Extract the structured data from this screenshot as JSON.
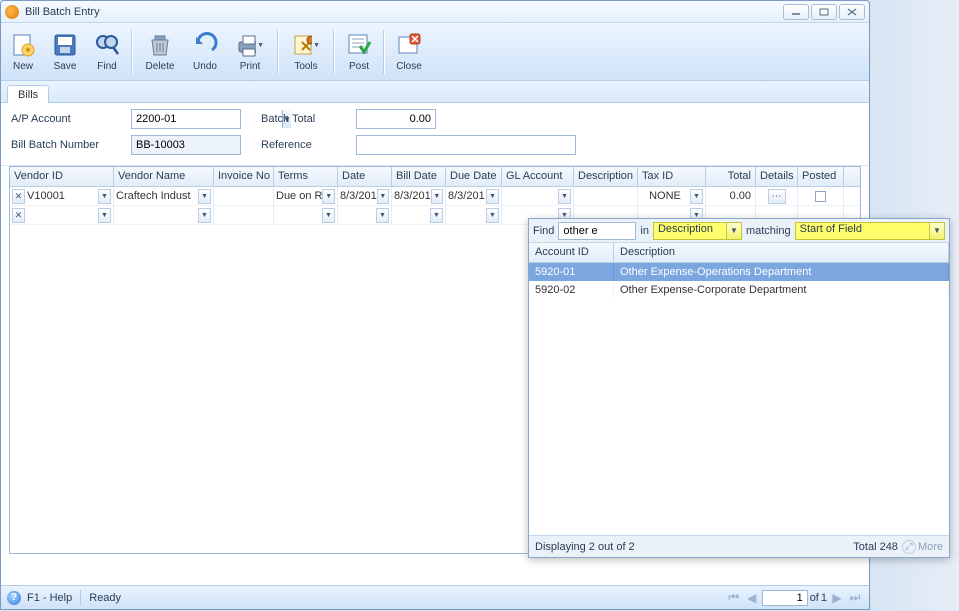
{
  "window": {
    "title": "Bill Batch Entry",
    "min": "—",
    "max": "▢",
    "close": "✕"
  },
  "toolbar": {
    "new": "New",
    "save": "Save",
    "find": "Find",
    "delete": "Delete",
    "undo": "Undo",
    "print": "Print",
    "tools": "Tools",
    "post": "Post",
    "close": "Close"
  },
  "tabs": {
    "bills": "Bills"
  },
  "form": {
    "ap_account_label": "A/P Account",
    "ap_account_value": "2200-01",
    "bill_batch_label": "Bill Batch Number",
    "bill_batch_value": "BB-10003",
    "batch_total_label": "Batch Total",
    "batch_total_value": "0.00",
    "reference_label": "Reference",
    "reference_value": ""
  },
  "grid": {
    "headers": {
      "vendor_id": "Vendor ID",
      "vendor_name": "Vendor Name",
      "invoice_no": "Invoice No",
      "terms": "Terms",
      "date": "Date",
      "bill_date": "Bill Date",
      "due_date": "Due Date",
      "gl_account": "GL Account",
      "description": "Description",
      "tax_id": "Tax ID",
      "total": "Total",
      "details": "Details",
      "posted": "Posted"
    },
    "rows": [
      {
        "vendor_id": "V10001",
        "vendor_name": "Craftech Indust",
        "invoice_no": "",
        "terms": "Due on R",
        "date": "8/3/201",
        "bill_date": "8/3/201",
        "due_date": "8/3/201",
        "gl_account": "",
        "description": "",
        "tax_id": "NONE",
        "total": "0.00"
      }
    ]
  },
  "lookup": {
    "find_label": "Find",
    "find_value": "other e",
    "in_label": "in",
    "in_value": "Description",
    "matching_label": "matching",
    "matching_value": "Start of Field",
    "headers": {
      "account_id": "Account ID",
      "description": "Description"
    },
    "rows": [
      {
        "account_id": "5920-01",
        "description": "Other Expense-Operations Department",
        "selected": true
      },
      {
        "account_id": "5920-02",
        "description": "Other Expense-Corporate Department",
        "selected": false
      }
    ],
    "status": "Displaying 2 out of 2",
    "total_label": "Total 248",
    "more_label": "More"
  },
  "status": {
    "help": "F1 - Help",
    "ready": "Ready",
    "page_value": "1",
    "of_label": "of",
    "page_total": "1"
  }
}
